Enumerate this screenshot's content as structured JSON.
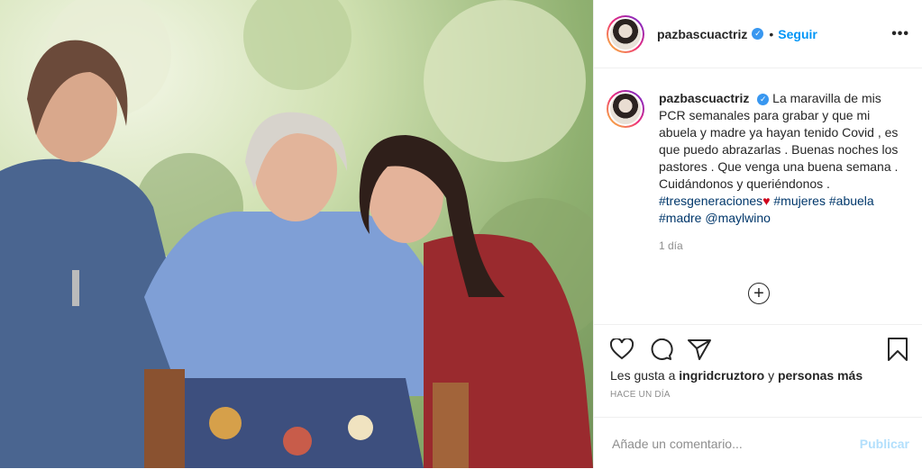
{
  "post": {
    "username": "pazbascuactriz",
    "follow_label": "Seguir",
    "dot": "•",
    "more_label": "•••",
    "verified_glyph": "✓",
    "photo_icon": "family-photo"
  },
  "caption": {
    "username": "pazbascuactriz",
    "text": "La maravilla de mis PCR semanales para grabar y que mi abuela y madre ya hayan tenido Covid , es que puedo abrazarlas . Buenas noches los pastores . Que venga una buena semana . Cuidándonos y queriéndonos .",
    "hashtag1": "#tresgeneraciones",
    "heart": "♥",
    "hashtags": [
      "#mujeres",
      "#abuela",
      "#madre",
      "@maylwino"
    ],
    "time": "1 día",
    "load_more": "+"
  },
  "actions": {
    "likes_prefix": "Les gusta a",
    "likes_user": "ingridcruztoro",
    "likes_and": "y",
    "likes_others": "personas más",
    "ago": "HACE UN DÍA"
  },
  "comment": {
    "placeholder": "Añade un comentario...",
    "publish_label": "Publicar"
  },
  "colors": {
    "link": "#0095f6",
    "publish_disabled": "#b2dffc",
    "heart": "#d0021b"
  }
}
